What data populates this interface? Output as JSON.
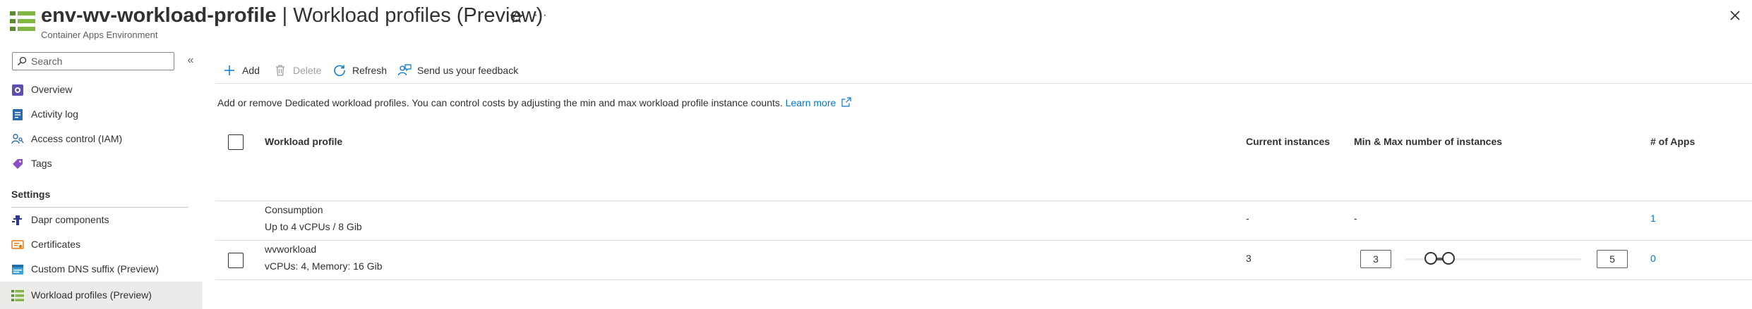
{
  "header": {
    "resource_name": "env-wv-workload-profile",
    "separator": " | ",
    "page_name": "Workload profiles (Preview)",
    "subtitle": "Container Apps Environment",
    "icon": "workload-profiles-icon",
    "star_icon": "star-icon",
    "more_label": "···",
    "close_icon": "close-icon"
  },
  "sidebar": {
    "search_placeholder": "Search",
    "collapse_label": "«",
    "items": [
      {
        "label": "Overview",
        "icon": "overview-icon"
      },
      {
        "label": "Activity log",
        "icon": "activity-log-icon"
      },
      {
        "label": "Access control (IAM)",
        "icon": "iam-icon"
      },
      {
        "label": "Tags",
        "icon": "tag-icon"
      }
    ],
    "section_settings": "Settings",
    "settings_items": [
      {
        "label": "Dapr components",
        "icon": "dapr-icon"
      },
      {
        "label": "Certificates",
        "icon": "certificate-icon"
      },
      {
        "label": "Custom DNS suffix (Preview)",
        "icon": "dns-icon"
      },
      {
        "label": "Workload profiles (Preview)",
        "icon": "workload-profiles-icon",
        "selected": true
      }
    ]
  },
  "toolbar": {
    "add": "Add",
    "delete": "Delete",
    "refresh": "Refresh",
    "feedback": "Send us your feedback"
  },
  "description": {
    "text": "Add or remove Dedicated workload profiles. You can control costs by adjusting the min and max workload profile instance counts. ",
    "learn_more": "Learn more"
  },
  "table": {
    "columns": [
      "Workload profile",
      "Current instances",
      "Min & Max number of instances",
      "# of Apps"
    ],
    "rows": [
      {
        "name": "Consumption",
        "detail": "Up to 4 vCPUs / 8 Gib",
        "current": "-",
        "minmax": "-",
        "apps": "1",
        "has_checkbox": false
      },
      {
        "name": "wvworkload",
        "detail": "vCPUs: 4, Memory: 16 Gib",
        "current": "3",
        "min": "3",
        "max": "5",
        "apps": "0",
        "has_checkbox": true
      }
    ]
  },
  "colors": {
    "accent": "#0078d4",
    "selected_bg": "#edebe9",
    "icon_green": "#5c8a2e"
  }
}
